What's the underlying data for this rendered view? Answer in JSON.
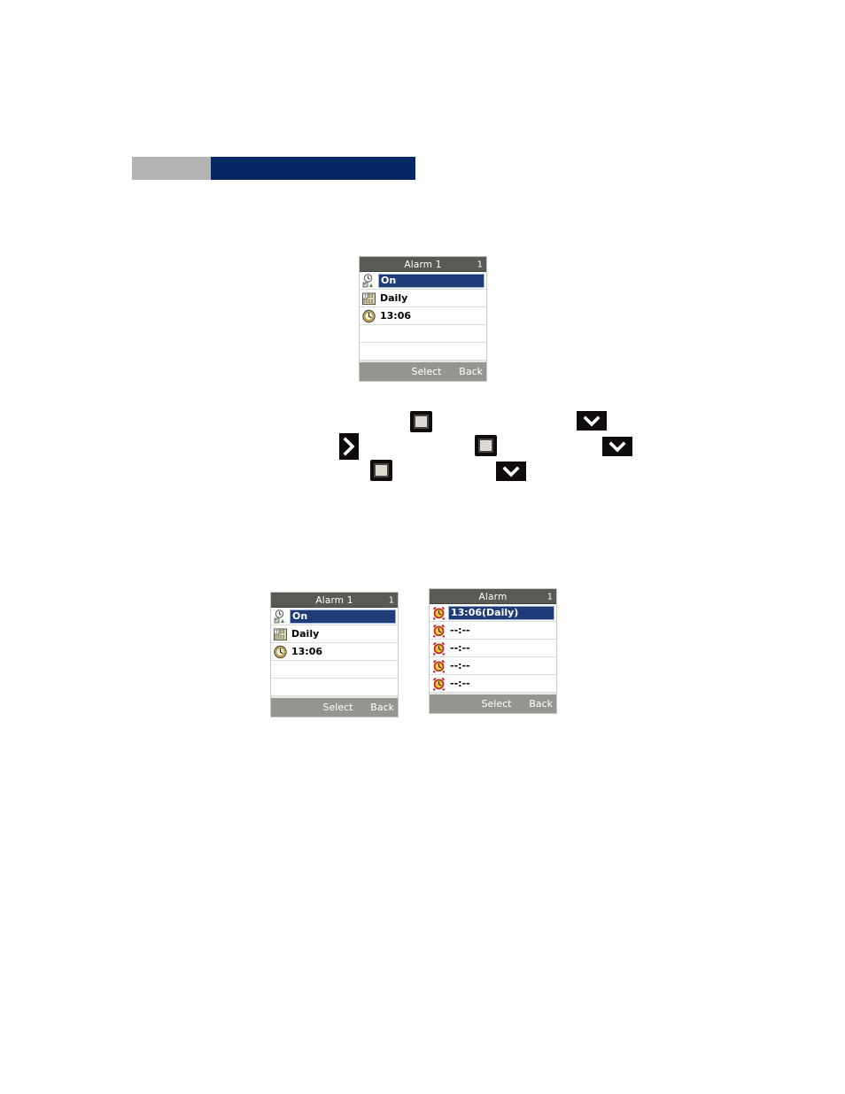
{
  "banner": {
    "left_color": "#b3b3b3",
    "right_color": "#062963"
  },
  "screens": [
    {
      "id": "alarm1-detail-top",
      "title": "Alarm 1",
      "index": "1",
      "rows": [
        {
          "icon": "alarm-person-icon",
          "label": "On",
          "selected": true
        },
        {
          "icon": "calendar-icon",
          "label": "Daily",
          "selected": false
        },
        {
          "icon": "clock-icon",
          "label": "13:06",
          "selected": false
        },
        {
          "icon": "",
          "label": "",
          "selected": false
        },
        {
          "icon": "",
          "label": "",
          "selected": false
        }
      ],
      "softkeys": {
        "center": "Select",
        "right": "Back"
      }
    },
    {
      "id": "alarm1-detail-bottom",
      "title": "Alarm 1",
      "index": "1",
      "rows": [
        {
          "icon": "alarm-person-icon",
          "label": "On",
          "selected": true
        },
        {
          "icon": "calendar-icon",
          "label": "Daily",
          "selected": false
        },
        {
          "icon": "clock-icon",
          "label": "13:06",
          "selected": false
        },
        {
          "icon": "",
          "label": "",
          "selected": false
        },
        {
          "icon": "",
          "label": "",
          "selected": false
        }
      ],
      "softkeys": {
        "center": "Select",
        "right": "Back"
      }
    },
    {
      "id": "alarm-list",
      "title": "Alarm",
      "index": "1",
      "rows": [
        {
          "icon": "alarm-clock-icon",
          "label": "13:06(Daily)",
          "selected": true
        },
        {
          "icon": "alarm-clock-icon",
          "label": "--:--",
          "selected": false
        },
        {
          "icon": "alarm-clock-icon",
          "label": "--:--",
          "selected": false
        },
        {
          "icon": "alarm-clock-icon",
          "label": "--:--",
          "selected": false
        },
        {
          "icon": "alarm-clock-icon",
          "label": "--:--",
          "selected": false
        }
      ],
      "softkeys": {
        "center": "Select",
        "right": "Back"
      }
    }
  ],
  "key_glyphs": [
    {
      "name": "arrow-right-key",
      "type": "arrow"
    },
    {
      "name": "select-key-1",
      "type": "square"
    },
    {
      "name": "select-key-2",
      "type": "square"
    },
    {
      "name": "select-key-3",
      "type": "square"
    },
    {
      "name": "down-key-1",
      "type": "chevron-down"
    },
    {
      "name": "down-key-2",
      "type": "chevron-down"
    },
    {
      "name": "down-key-3",
      "type": "chevron-down"
    }
  ]
}
